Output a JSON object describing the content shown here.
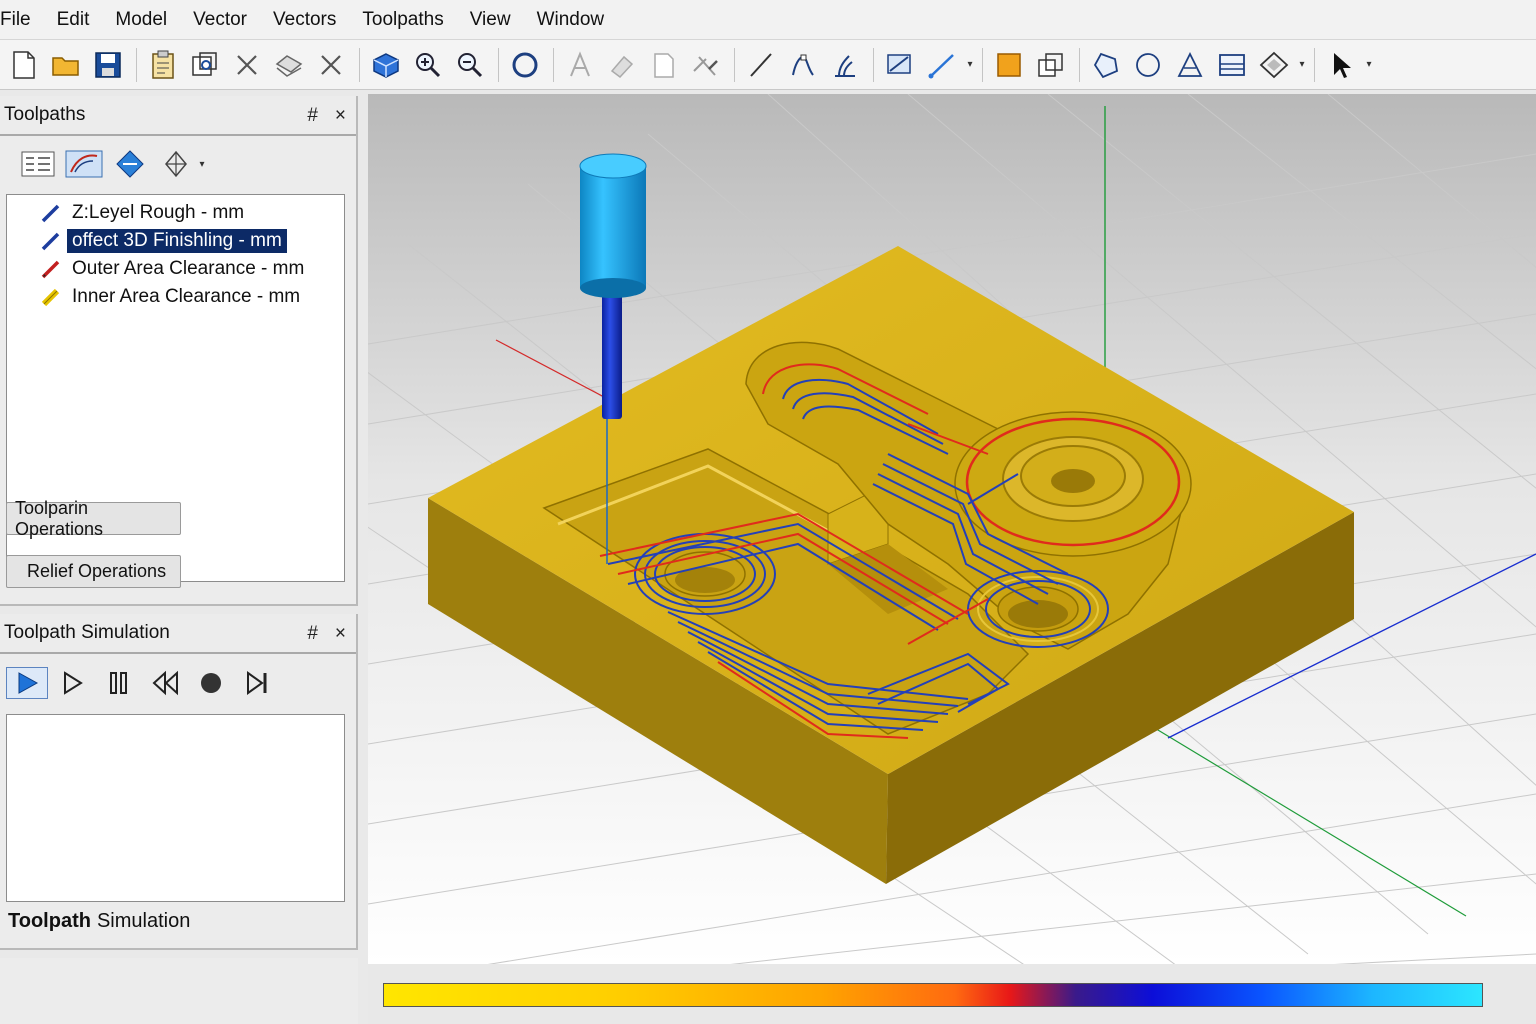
{
  "menu": [
    "File",
    "Edit",
    "Model",
    "Vector",
    "Vectors",
    "Toolpaths",
    "View",
    "Window"
  ],
  "toolbar_icons": [
    "new-file-icon",
    "open-folder-icon",
    "save-icon",
    "clipboard-icon",
    "import-icon",
    "cut-icon",
    "copy-icon",
    "delete-icon",
    "3d-view-icon",
    "zoom-in-icon",
    "zoom-out-icon",
    "circle-icon",
    "text-icon",
    "eraser-icon",
    "page-icon",
    "trim-icon",
    "line-icon",
    "node-edit-icon",
    "offset-icon",
    "transform-icon",
    "draw-line-icon",
    "square-icon",
    "copy-shape-icon",
    "polygon-icon",
    "ellipse-icon",
    "star-icon",
    "image-icon",
    "diamond-icon",
    "pointer-icon"
  ],
  "toolpaths_panel": {
    "title": "Toolpaths",
    "pin": "#",
    "close": "×",
    "items": [
      {
        "label": "Z:Leyel Rough - mm",
        "color": "#1d3d9e"
      },
      {
        "label": "offect 3D Finishling - mm",
        "color": "#1d3d9e"
      },
      {
        "label": "Outer Area Clearance - mm",
        "color": "#c22020"
      },
      {
        "label": "Inner Area Clearance - mm",
        "color": "#e6c400"
      }
    ],
    "buttons": {
      "toolpath_ops": "Toolparin Operations",
      "relief_ops": "Relief Operations"
    }
  },
  "simulation_panel": {
    "title": "Toolpath Simulation",
    "pin": "#",
    "close": "×",
    "footer_bold": "Toolpath",
    "footer_text": "Simulation"
  },
  "colors": {
    "material": "#d8b219",
    "material_dark": "#9d7d0e",
    "toolpath_blue": "#2440b8",
    "toolpath_red": "#e02b1c",
    "tool_cyan": "#1aa2d8",
    "tool_shank": "#1434c4",
    "selection": "#0c2a66"
  }
}
